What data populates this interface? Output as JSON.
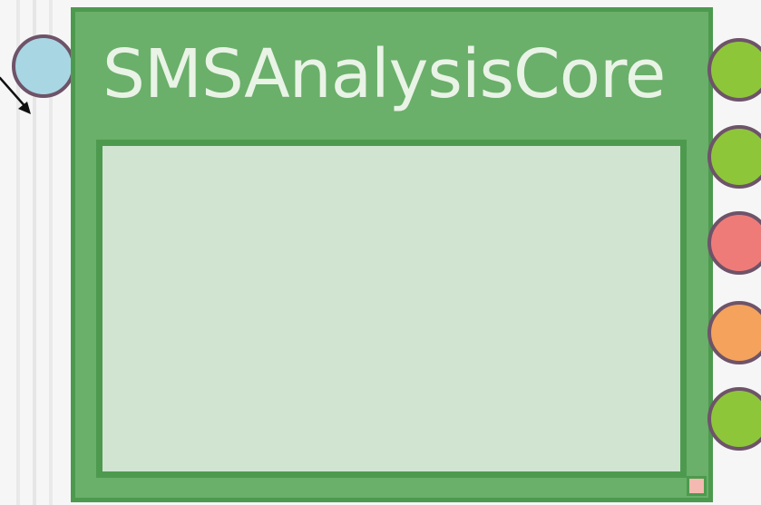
{
  "node": {
    "title": "SMSAnalysisCore",
    "body_color": "#d0e4d1",
    "header_color": "#6aaf6a",
    "border_color": "#4d9a4f"
  },
  "ports": {
    "input": [
      {
        "name": "input-port",
        "color": "#a9d6e3"
      }
    ],
    "outputs": [
      {
        "name": "output-port-1",
        "color": "#8ec63a"
      },
      {
        "name": "output-port-2",
        "color": "#8ec63a"
      },
      {
        "name": "output-port-3",
        "color": "#ef7b79"
      },
      {
        "name": "output-port-4",
        "color": "#f4a25c"
      },
      {
        "name": "output-port-5",
        "color": "#8ec63a"
      }
    ]
  },
  "icons": {
    "connection": "arrow-icon",
    "resize": "resize-handle-icon"
  }
}
